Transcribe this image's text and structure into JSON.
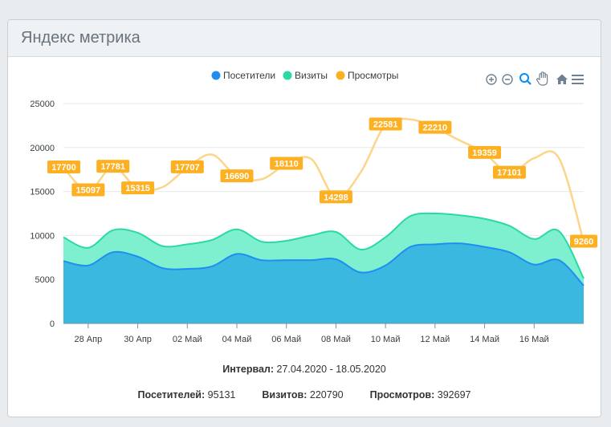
{
  "header": {
    "title": "Яндекс метрика"
  },
  "toolbar": {
    "icons": [
      "zoom-in-icon",
      "zoom-out-icon",
      "selection-zoom-icon",
      "pan-icon",
      "reset-home-icon",
      "menu-icon"
    ]
  },
  "summary": {
    "interval_label": "Интервал:",
    "interval_value": "27.04.2020 - 18.05.2020",
    "visitors_label": "Посетителей:",
    "visitors_value": "95131",
    "visits_label": "Визитов:",
    "visits_value": "220790",
    "views_label": "Просмотров:",
    "views_value": "392697"
  },
  "chart_data": {
    "type": "area",
    "dates": [
      "27.04",
      "28.04",
      "29.04",
      "30.04",
      "01.05",
      "02.05",
      "03.05",
      "04.05",
      "05.05",
      "06.05",
      "07.05",
      "08.05",
      "09.05",
      "10.05",
      "11.05",
      "12.05",
      "13.05",
      "14.05",
      "15.05",
      "16.05",
      "17.05",
      "18.05"
    ],
    "x_tick_labels": [
      "28 Апр",
      "30 Апр",
      "02 Май",
      "04 Май",
      "06 Май",
      "08 Май",
      "10 Май",
      "12 Май",
      "14 Май",
      "16 Май"
    ],
    "y_ticks": [
      0,
      5000,
      10000,
      15000,
      20000,
      25000
    ],
    "ylim": [
      0,
      25000
    ],
    "series": [
      {
        "name": "Посетители",
        "color": "#1f8ef1",
        "values": [
          7100,
          6600,
          8100,
          7600,
          6300,
          6200,
          6500,
          7900,
          7200,
          7200,
          7200,
          7300,
          5800,
          6600,
          8700,
          9000,
          9100,
          8700,
          8100,
          6700,
          7200,
          4300
        ]
      },
      {
        "name": "Визиты",
        "color": "#2ad9a3",
        "values": [
          9800,
          8600,
          10600,
          10300,
          8800,
          9000,
          9500,
          10700,
          9300,
          9400,
          10000,
          10400,
          8400,
          9800,
          12200,
          12500,
          12300,
          11900,
          11100,
          9600,
          10500,
          5100
        ]
      },
      {
        "name": "Просмотры",
        "color": "#fdb022",
        "values": [
          17700,
          15097,
          17781,
          15315,
          15500,
          17707,
          19200,
          16690,
          16400,
          18110,
          18700,
          14298,
          17200,
          22581,
          23200,
          22210,
          20800,
          19359,
          17101,
          18800,
          18800,
          9260
        ],
        "labeled_values": [
          17700,
          15097,
          17781,
          15315,
          17707,
          16690,
          18110,
          14298,
          22581,
          22210,
          19359,
          17101,
          9260
        ]
      }
    ]
  }
}
